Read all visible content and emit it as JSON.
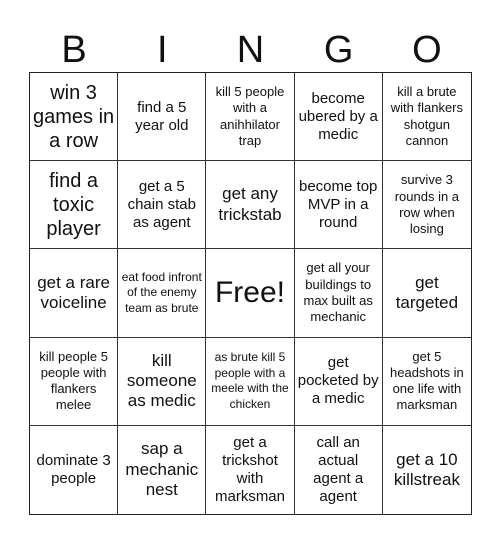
{
  "header": {
    "letters": [
      "B",
      "I",
      "N",
      "G",
      "O"
    ]
  },
  "cells": [
    "win 3 games in a row",
    "find a 5 year old",
    "kill 5 people with a anihhilator trap",
    "become ubered by a medic",
    "kill a brute with flankers shotgun cannon",
    "find a toxic player",
    "get a 5 chain stab as agent",
    "get any trickstab",
    "become top MVP in a round",
    "survive 3 rounds in a row when losing",
    "get a rare voiceline",
    "eat food infront of the enemy team as brute",
    "Free!",
    "get all your buildings to max built as mechanic",
    "get targeted",
    "kill people 5 people with flankers melee",
    "kill someone as medic",
    "as brute kill 5 people with a meele with the chicken",
    "get pocketed by a medic",
    "get 5 headshots in one life with marksman",
    "dominate 3 people",
    "sap a mechanic nest",
    "get a trickshot with marksman",
    "call an actual agent a agent",
    "get a 10 killstreak"
  ]
}
